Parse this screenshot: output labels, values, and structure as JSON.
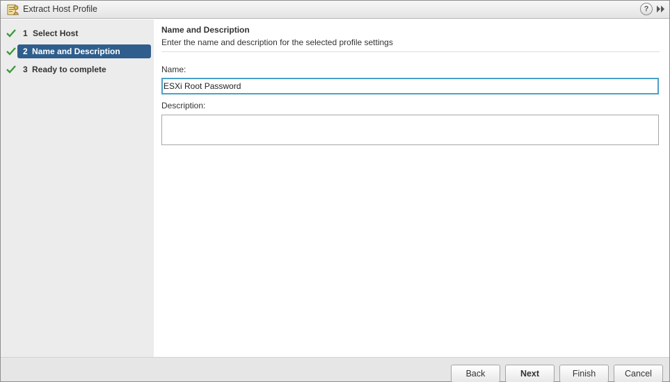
{
  "window": {
    "title": "Extract Host Profile",
    "help_glyph": "?",
    "icons": {
      "title": "profile-icon",
      "help": "help-icon",
      "collapse": "double-chevron-right-icon"
    }
  },
  "steps": [
    {
      "number": "1",
      "label": "Select Host",
      "complete": true,
      "active": false
    },
    {
      "number": "2",
      "label": "Name and Description",
      "complete": true,
      "active": true
    },
    {
      "number": "3",
      "label": "Ready to complete",
      "complete": true,
      "active": false
    }
  ],
  "main": {
    "section_title": "Name and Description",
    "section_description": "Enter the name and description for the selected profile settings",
    "name_label": "Name:",
    "name_value": "ESXi Root Password",
    "description_label": "Description:",
    "description_value": ""
  },
  "footer": {
    "back": "Back",
    "next": "Next",
    "finish": "Finish",
    "cancel": "Cancel"
  },
  "colors": {
    "active_step": "#2f5e8c",
    "check": "#3c9a3c",
    "focus_border": "#4aa0c8"
  }
}
